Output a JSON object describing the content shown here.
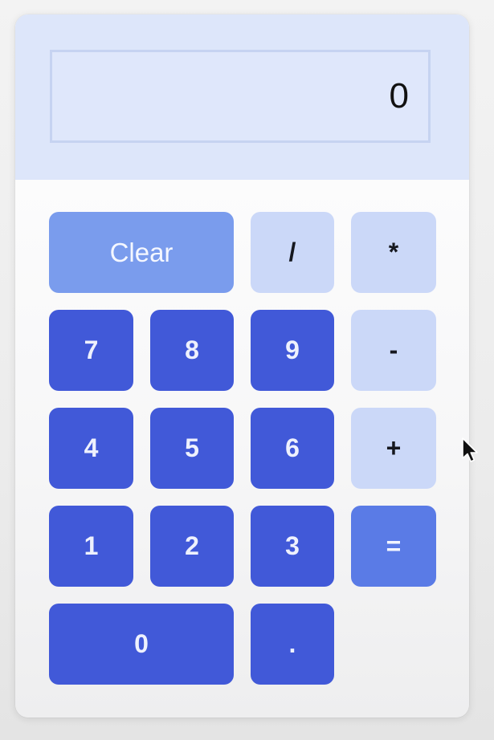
{
  "display": {
    "value": "0"
  },
  "keys": {
    "clear": "Clear",
    "divide": "/",
    "multiply": "*",
    "seven": "7",
    "eight": "8",
    "nine": "9",
    "subtract": "-",
    "four": "4",
    "five": "5",
    "six": "6",
    "add": "+",
    "one": "1",
    "two": "2",
    "three": "3",
    "equals": "=",
    "zero": "0",
    "decimal": "."
  },
  "colors": {
    "display_panel": "#dde6fa",
    "number_key": "#4159d8",
    "operator_key": "#cbd8f8",
    "clear_key": "#7a9ced",
    "equals_key": "#5a7be6"
  },
  "icons": {
    "pointer": "mouse-pointer-icon"
  }
}
